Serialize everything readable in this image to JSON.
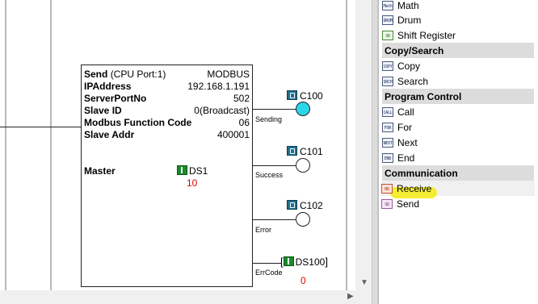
{
  "instruction": {
    "title_bold": "Send",
    "title_suffix": "(CPU Port:1)",
    "protocol": "MODBUS",
    "params": [
      {
        "label": "IPAddress",
        "value": "192.168.1.191"
      },
      {
        "label": "ServerPortNo",
        "value": "502"
      },
      {
        "label": "Slave ID",
        "value": "0(Broadcast)"
      },
      {
        "label": "Modbus Function Code",
        "value": "06"
      },
      {
        "label": "Slave Addr",
        "value": "400001"
      }
    ],
    "master_label": "Master",
    "master_addr": "DS1",
    "master_value": "10"
  },
  "outputs": [
    {
      "tag": "C100",
      "label": "Sending",
      "state": "on"
    },
    {
      "tag": "C101",
      "label": "Success",
      "state": "off"
    },
    {
      "tag": "C102",
      "label": "Error",
      "state": "off"
    }
  ],
  "errcode": {
    "label": "ErrCode",
    "addr": "DS100",
    "value": "0"
  },
  "palette": {
    "items_top": [
      {
        "icon": "Math",
        "label": "Math"
      },
      {
        "icon": "DRUM",
        "label": "Drum"
      },
      {
        "icon": "SR",
        "label": "Shift Register"
      }
    ],
    "copy_header": "Copy/Search",
    "copy_items": [
      {
        "icon": "COPY",
        "label": "Copy"
      },
      {
        "icon": "SRCH",
        "label": "Search"
      }
    ],
    "program_header": "Program Control",
    "program_items": [
      {
        "icon": "CALL",
        "label": "Call"
      },
      {
        "icon": "FOR",
        "label": "For"
      },
      {
        "icon": "NEXT",
        "label": "Next"
      },
      {
        "icon": "END",
        "label": "End"
      }
    ],
    "comm_header": "Communication",
    "comm_items": [
      {
        "icon": "RD",
        "label": "Receive"
      },
      {
        "icon": "SD",
        "label": "Send"
      }
    ]
  },
  "colors": {
    "coil_on": "#2ad6ea",
    "highlight": "#f3ec1e",
    "value_red": "#e00000"
  }
}
